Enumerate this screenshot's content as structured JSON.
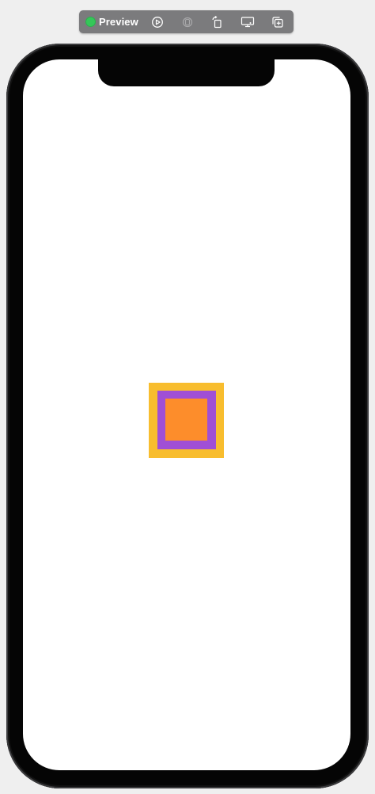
{
  "toolbar": {
    "title": "Preview",
    "status_color": "#35c759",
    "icons": [
      {
        "name": "live-preview-play-icon",
        "interactable": true
      },
      {
        "name": "preview-variants-icon",
        "interactable": false,
        "disabled": true
      },
      {
        "name": "rotate-device-icon",
        "interactable": true
      },
      {
        "name": "device-settings-icon",
        "interactable": true
      },
      {
        "name": "duplicate-preview-icon",
        "interactable": true
      }
    ]
  },
  "device": {
    "frame_color": "#050505",
    "screen_color": "#ffffff"
  },
  "content": {
    "squares": [
      {
        "name": "outer-square",
        "color": "#f8bd2e"
      },
      {
        "name": "middle-square",
        "color": "#a04fd5"
      },
      {
        "name": "inner-square",
        "color": "#fd8d2b"
      }
    ]
  }
}
